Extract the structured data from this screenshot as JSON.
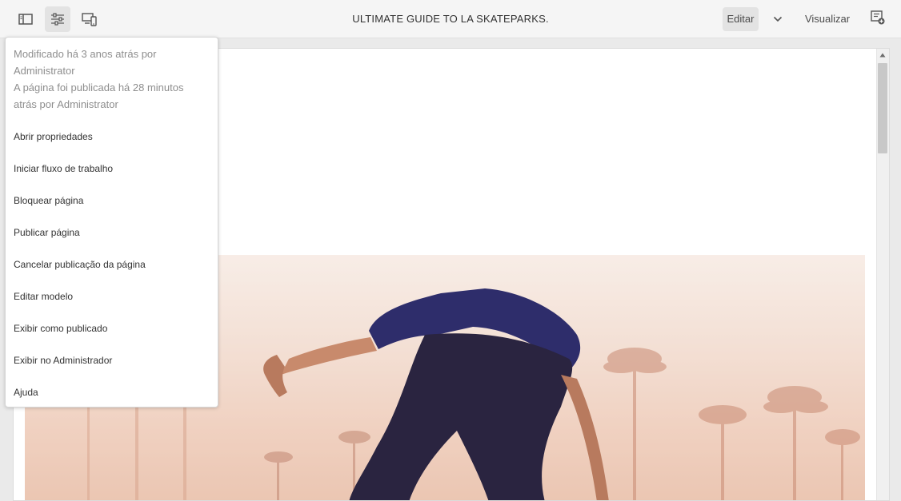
{
  "toolbar": {
    "page_title": "ULTIMATE GUIDE TO LA SKATEPARKS.",
    "edit_label": "Editar",
    "preview_label": "Visualizar",
    "icons": {
      "side_panel": "side-panel-icon",
      "page_information": "sliders-icon",
      "emulator": "device-emulator-icon",
      "mode_dropdown": "chevron-down-icon",
      "annotations": "annotation-add-icon"
    }
  },
  "page_info": {
    "modified": "Modificado há 3 anos atrás por Administrator",
    "published": "A página foi publicada há 28 minutos atrás por Administrator",
    "menu": [
      "Abrir propriedades",
      "Iniciar fluxo de trabalho",
      "Bloquear página",
      "Publicar página",
      "Cancelar publicação da página",
      "Editar modelo",
      "Exibir como publicado",
      "Exibir no Administrador",
      "Ajuda"
    ]
  },
  "colors": {
    "toolbar_bg": "#f5f5f5",
    "active_button_bg": "#e3e3e3",
    "menu_text": "#323232",
    "info_text": "#8e8e8e",
    "shirt": "#2e2d6b",
    "pants": "#2a2440"
  }
}
